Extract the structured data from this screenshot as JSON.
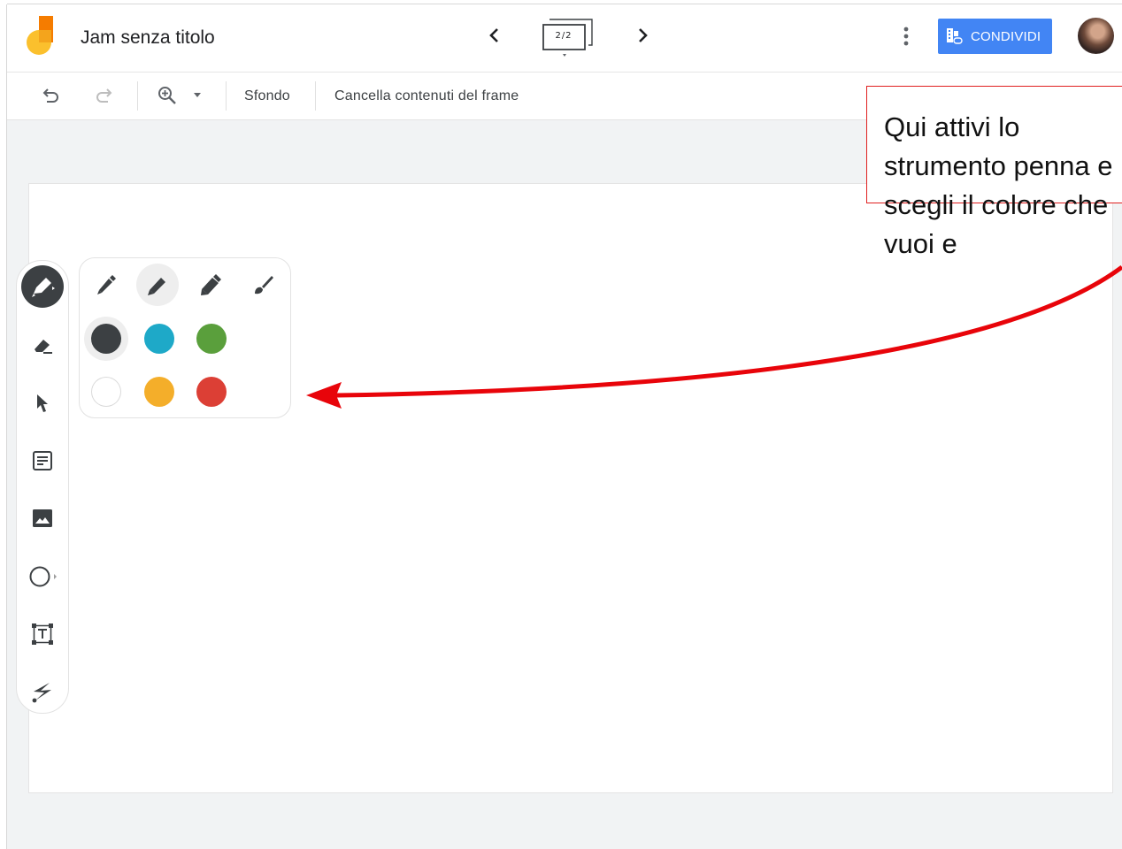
{
  "header": {
    "doc_title": "Jam senza titolo",
    "frame_counter": "2/2",
    "share_label": "CONDIVIDI"
  },
  "toolbar": {
    "background_label": "Sfondo",
    "clear_frame_label": "Cancella contenuti del frame"
  },
  "tools": [
    "pen-tool",
    "eraser-tool",
    "select-tool",
    "sticky-note-tool",
    "image-tool",
    "shape-tool",
    "text-box-tool",
    "laser-tool"
  ],
  "palette": {
    "pens": [
      "pen",
      "marker",
      "highlighter",
      "brush"
    ],
    "selected_pen": "marker",
    "colors": [
      "#3c4043",
      "#1ea9c8",
      "#5a9f3c",
      "#ffffff",
      "#f4ae2a",
      "#dc3f35"
    ],
    "selected_color": "#3c4043"
  },
  "annotation": {
    "text": "Qui attivi lo strumento penna e scegli il colore che vuoi e",
    "border_color": "#e02020",
    "arrow_color": "#e8040a"
  },
  "colors": {
    "brand_accent": "#4285f4",
    "logo_yellow": "#fbc02d",
    "logo_orange": "#f57c00"
  }
}
